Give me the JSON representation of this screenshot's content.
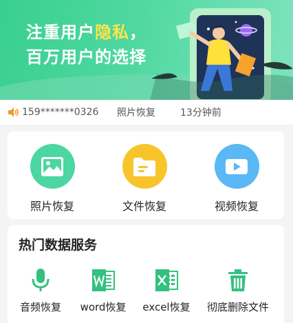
{
  "banner": {
    "line1_prefix": "注重用户",
    "line1_highlight": "隐私",
    "line1_suffix": "，",
    "line2": "百万用户的选择"
  },
  "notice": {
    "phone": "159*******0326",
    "action": "照片恢复",
    "time": "13分钟前"
  },
  "main_actions": [
    {
      "label": "照片恢复",
      "icon": "photo-icon",
      "color": "#4cd6a1"
    },
    {
      "label": "文件恢复",
      "icon": "folder-icon",
      "color": "#f7c52b"
    },
    {
      "label": "视频恢复",
      "icon": "video-icon",
      "color": "#5ab8f5"
    }
  ],
  "services": {
    "title": "热门数据服务",
    "items": [
      {
        "label": "音频恢复",
        "icon": "microphone-icon"
      },
      {
        "label": "word恢复",
        "icon": "word-icon"
      },
      {
        "label": "excel恢复",
        "icon": "excel-icon"
      },
      {
        "label": "彻底删除文件",
        "icon": "trash-icon"
      }
    ],
    "icon_color": "#34c07e"
  }
}
